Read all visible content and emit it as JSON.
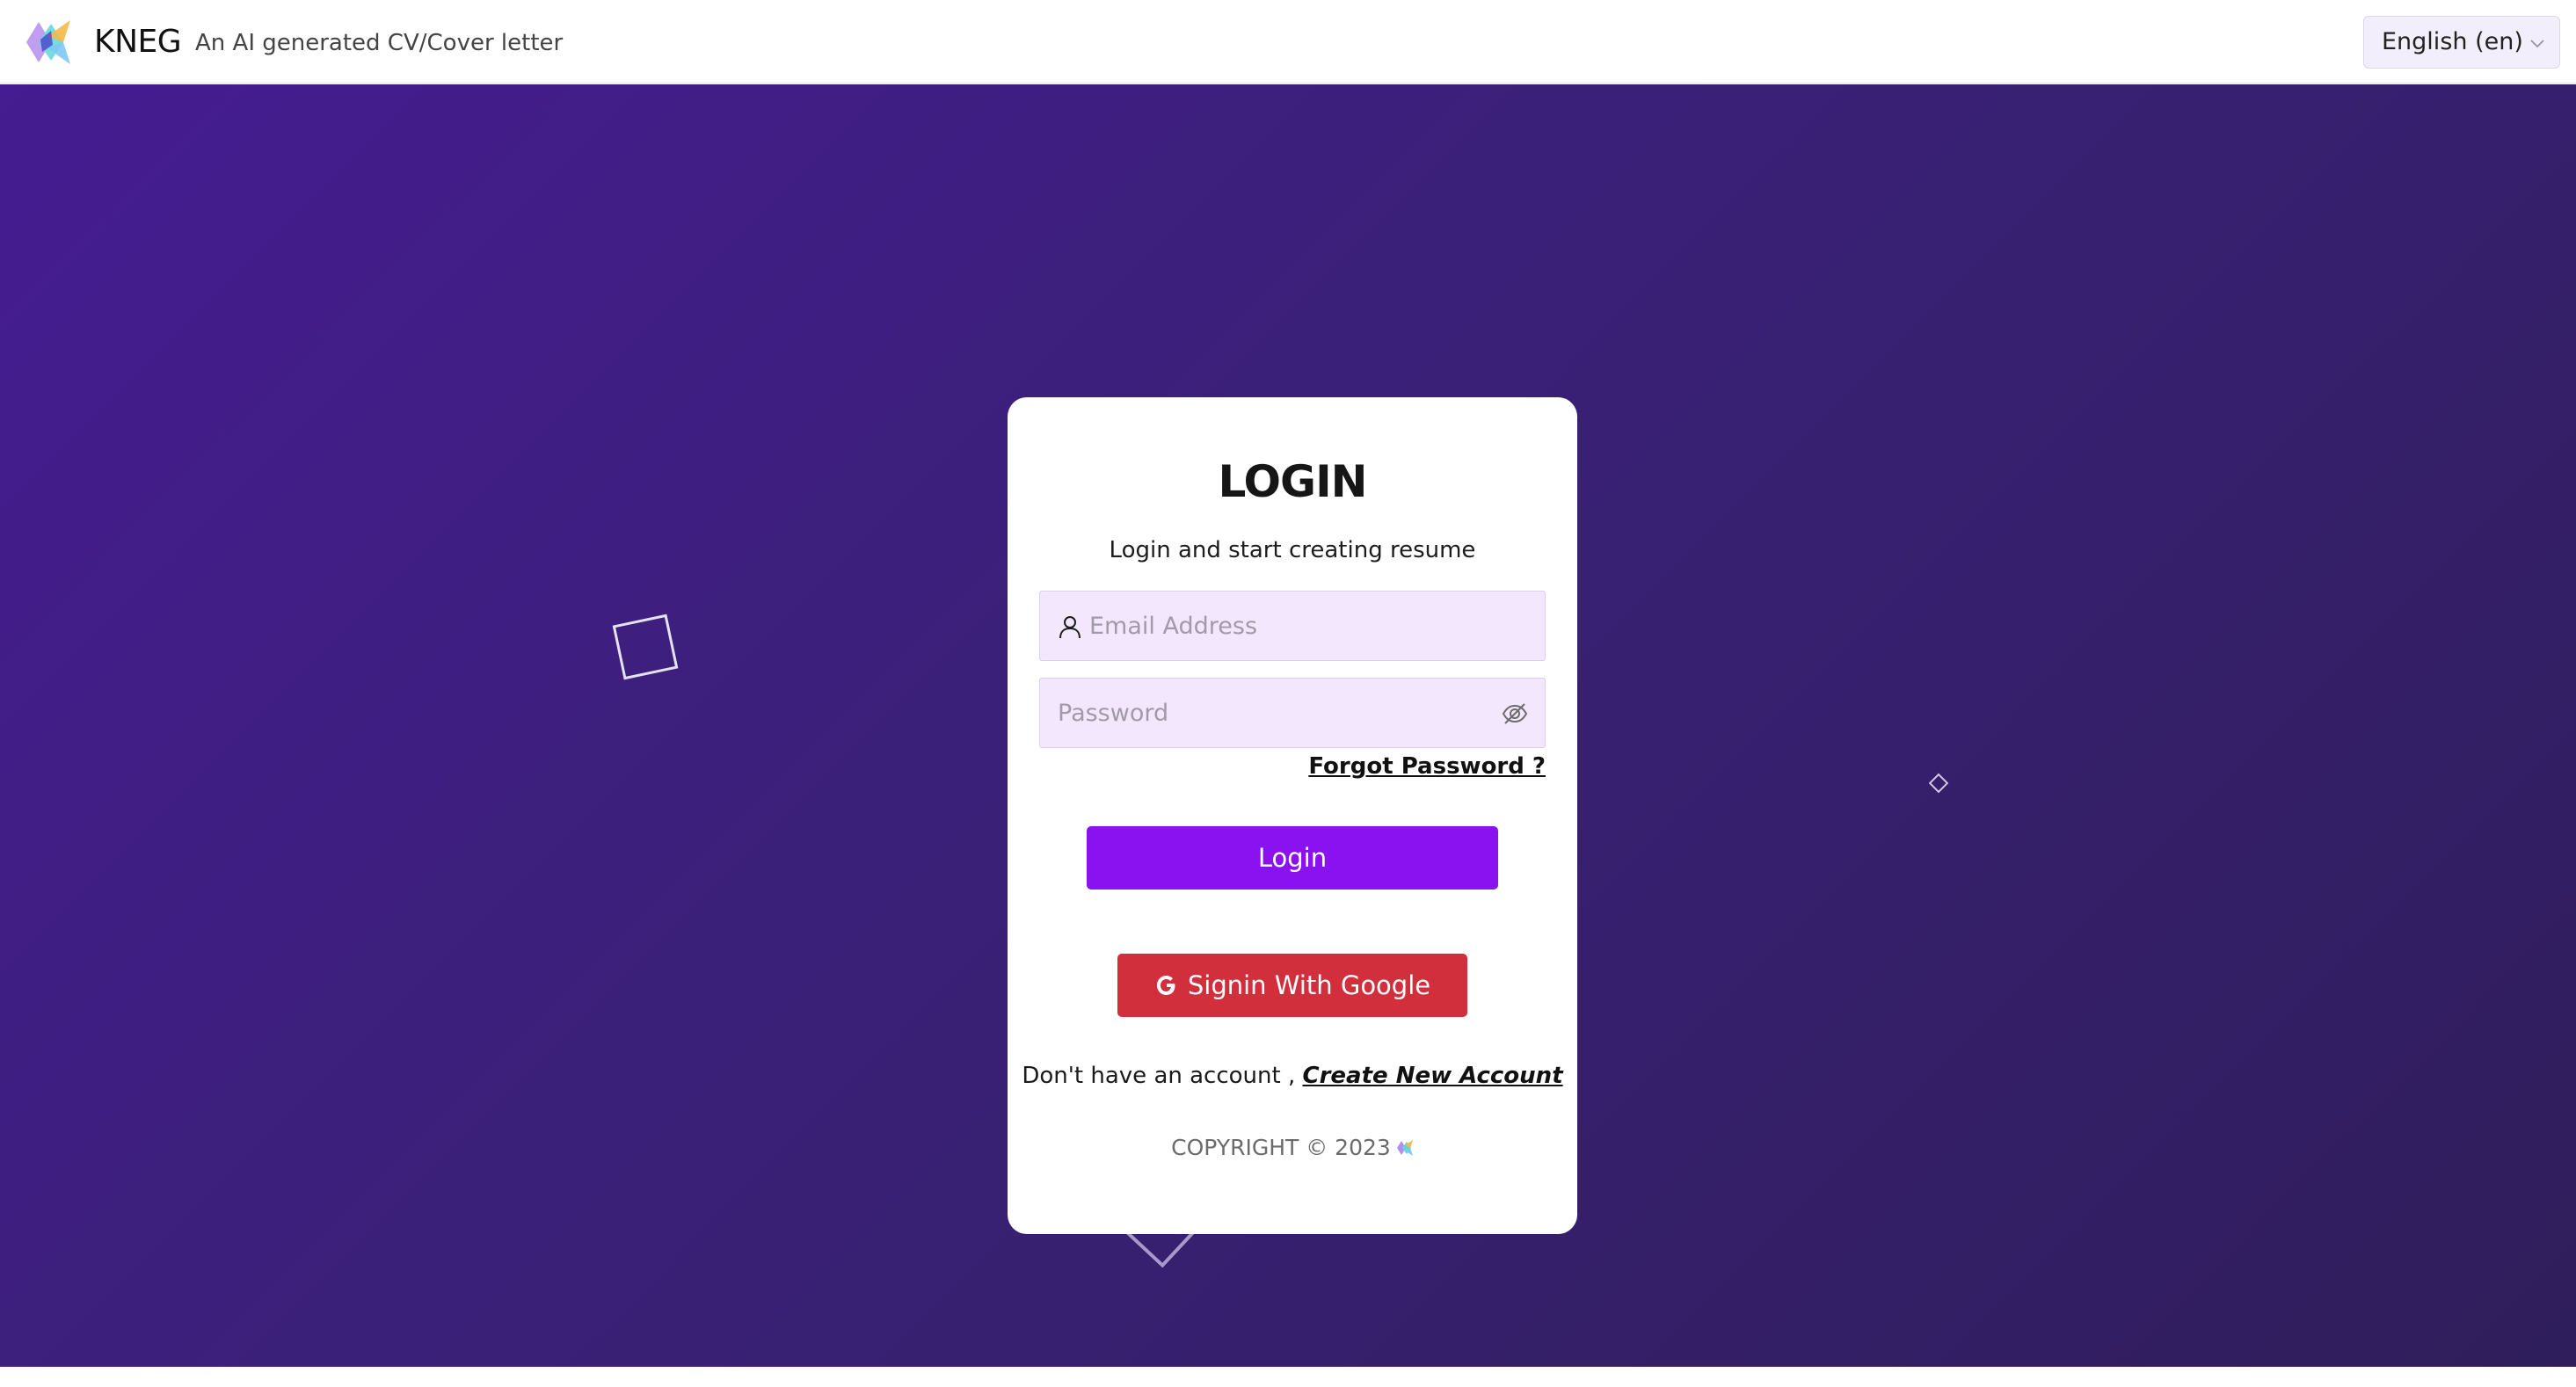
{
  "header": {
    "brand_name": "KNEG",
    "tagline": "An AI generated CV/Cover letter",
    "language": "English (en)"
  },
  "login": {
    "title": "LOGIN",
    "subtitle": "Login and start creating resume",
    "email_placeholder": "Email Address",
    "password_placeholder": "Password",
    "forgot_password": "Forgot Password ?",
    "login_button": "Login",
    "google_button": "Signin With Google",
    "no_account_text": "Don't have an account ,",
    "create_account_link": "Create New Account",
    "copyright": "COPYRIGHT © 2023"
  },
  "colors": {
    "primary_button": "#8a12f0",
    "google_button": "#d12f3c",
    "background_start": "#451c91",
    "background_end": "#2f1e5b",
    "input_background": "#f2e7fd"
  },
  "icons": {
    "brand_logo": "kneg-logo-icon",
    "language_dropdown": "chevron-down-icon",
    "email_field": "user-icon",
    "password_toggle": "eye-slash-icon",
    "google": "google-g-icon"
  }
}
